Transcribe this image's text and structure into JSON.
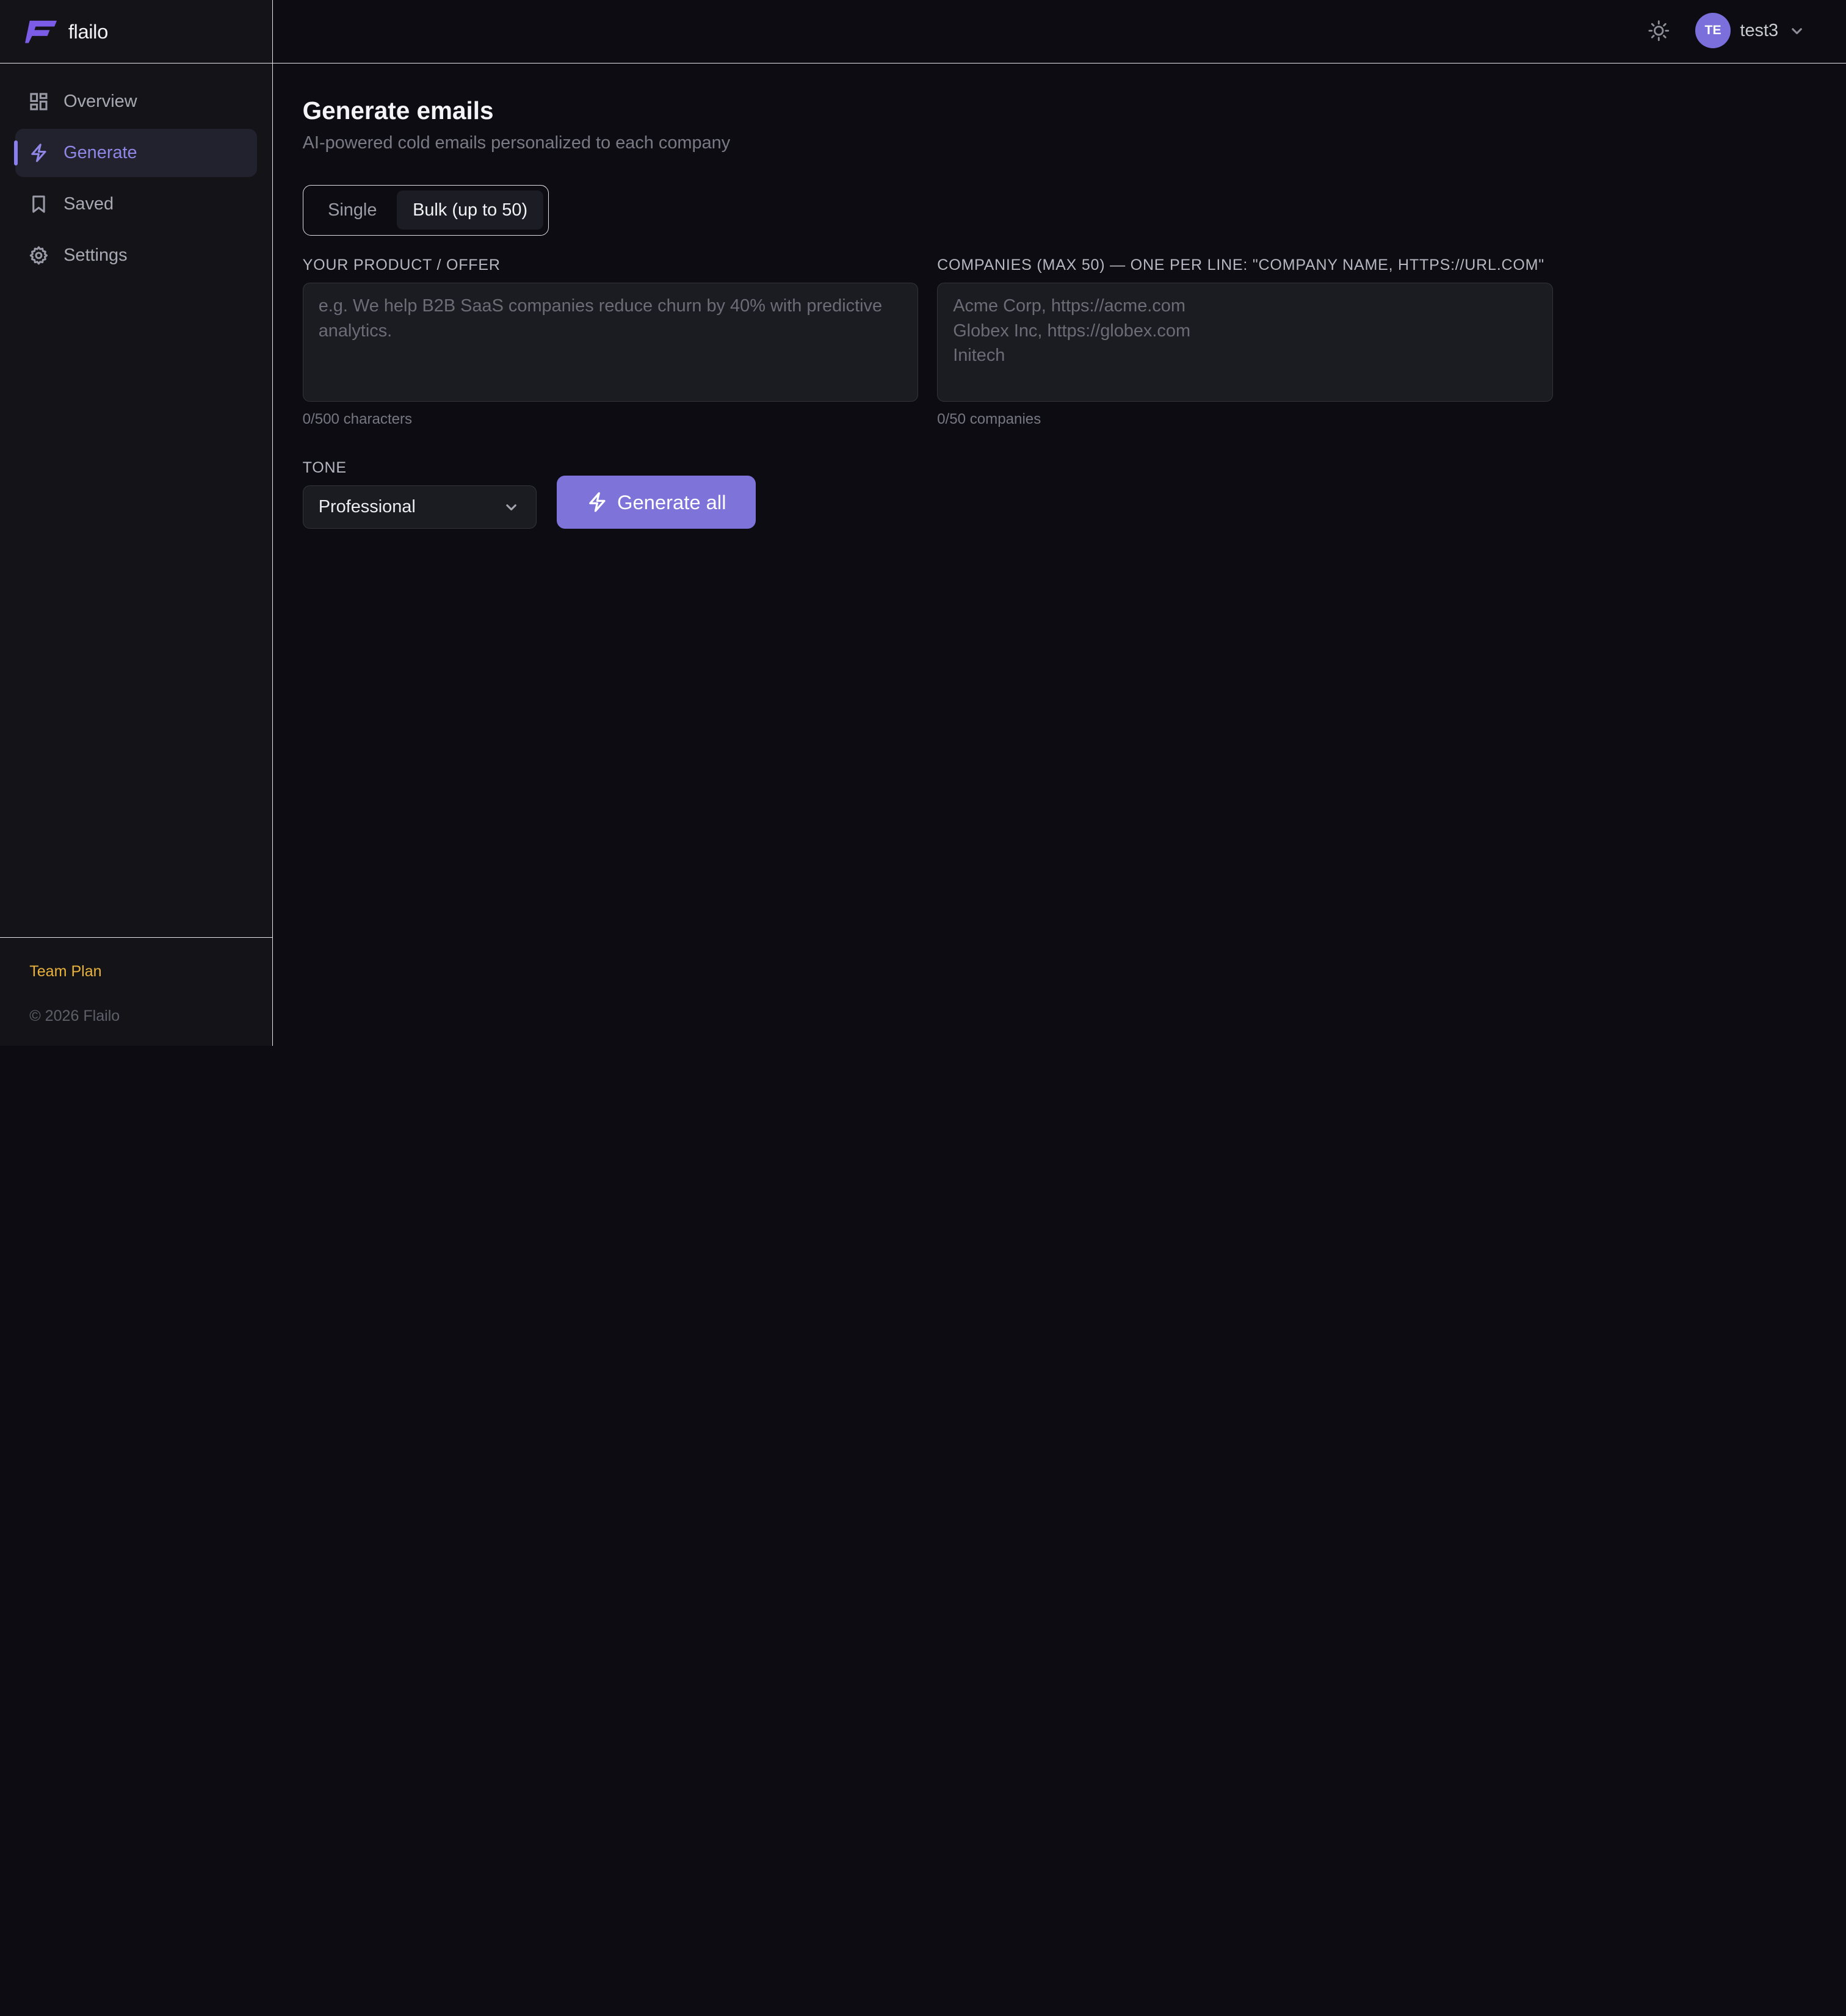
{
  "brand": {
    "name": "flailo"
  },
  "sidebar": {
    "items": [
      {
        "label": "Overview",
        "icon": "dashboard-icon",
        "active": false
      },
      {
        "label": "Generate",
        "icon": "lightning-icon",
        "active": true
      },
      {
        "label": "Saved",
        "icon": "bookmark-icon",
        "active": false
      },
      {
        "label": "Settings",
        "icon": "gear-icon",
        "active": false
      }
    ],
    "plan": "Team Plan",
    "copyright": "© 2026 Flailo"
  },
  "topbar": {
    "theme_icon": "sun-icon",
    "avatar_initials": "TE",
    "username": "test3"
  },
  "page": {
    "title": "Generate emails",
    "subtitle": "AI-powered cold emails personalized to each company"
  },
  "mode": {
    "options": [
      "Single",
      "Bulk (up to 50)"
    ],
    "selected": "Bulk (up to 50)"
  },
  "product": {
    "label": "YOUR PRODUCT / OFFER",
    "value": "",
    "placeholder": "e.g. We help B2B SaaS companies reduce churn by 40% with predictive analytics.",
    "counter": "0/500 characters"
  },
  "companies": {
    "label": "COMPANIES (MAX 50) — ONE PER LINE: \"COMPANY NAME, HTTPS://URL.COM\"",
    "value": "",
    "placeholder": "Acme Corp, https://acme.com\nGlobex Inc, https://globex.com\nInitech",
    "counter": "0/50 companies"
  },
  "tone": {
    "label": "TONE",
    "selected": "Professional"
  },
  "generate": {
    "label": "Generate all"
  },
  "colors": {
    "accent": "#7d73d9",
    "active_nav_text": "#8f86e6",
    "plan": "#e9b23a",
    "background": "#0c0c12",
    "sidebar": "#131318"
  }
}
